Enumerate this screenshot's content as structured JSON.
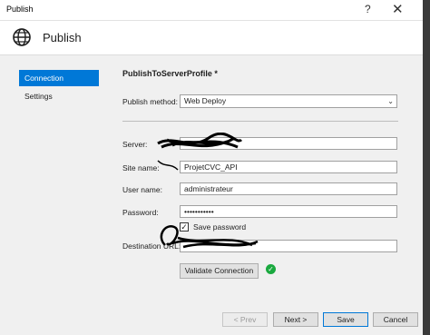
{
  "window": {
    "title": "Publish",
    "help_glyph": "?",
    "close_glyph": "✕"
  },
  "header": {
    "title": "Publish",
    "icon": "globe-icon"
  },
  "nav": {
    "items": [
      {
        "label": "Connection",
        "active": true
      },
      {
        "label": "Settings",
        "active": false
      }
    ]
  },
  "profile": {
    "title": "PublishToServerProfile *"
  },
  "form": {
    "publish_method_label": "Publish method:",
    "publish_method_value": "Web Deploy",
    "server_label": "Server:",
    "server_value": "",
    "site_name_label": "Site name:",
    "site_name_value": "ProjetCVC_API",
    "user_name_label": "User name:",
    "user_name_value": "administrateur",
    "password_label": "Password:",
    "password_value": "•••••••••••",
    "save_password_label": "Save password",
    "save_password_checked": true,
    "destination_url_label": "Destination URL:",
    "destination_url_value": "",
    "validate_label": "Validate Connection",
    "validation_status": "success"
  },
  "footer": {
    "prev_label": "< Prev",
    "next_label": "Next >",
    "save_label": "Save",
    "cancel_label": "Cancel"
  },
  "colors": {
    "accent": "#0078d7",
    "success": "#1aa93f"
  }
}
